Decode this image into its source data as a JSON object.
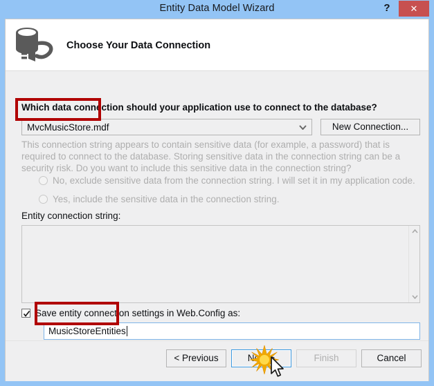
{
  "window": {
    "title": "Entity Data Model Wizard",
    "help_label": "?",
    "close_label": "✕"
  },
  "header": {
    "title": "Choose Your Data Connection",
    "icon": "database-connection-icon"
  },
  "main": {
    "prompt": "Which data connection should your application use to connect to the database?",
    "connection": {
      "selected_value": "MvcMusicStore.mdf",
      "dropdown_icon": "chevron-down-icon",
      "new_connection_label": "New Connection..."
    },
    "sensitive_data_notice": "This connection string appears to contain sensitive data (for example, a password) that is required to connect to the database. Storing sensitive data in the connection string can be a security risk. Do you want to include this sensitive data in the connection string?",
    "radio_options": [
      {
        "label": "No, exclude sensitive data from the connection string. I will set it in my application code.",
        "selected": false,
        "enabled": false
      },
      {
        "label": "Yes, include the sensitive data in the connection string.",
        "selected": false,
        "enabled": false
      }
    ],
    "entity_connection_string": {
      "label": "Entity connection string:",
      "value": "",
      "scroll_up_icon": "chevron-up-icon",
      "scroll_down_icon": "chevron-down-icon"
    },
    "save_settings": {
      "checkbox_label": "Save entity connection settings in Web.Config as:",
      "checked": true,
      "check_icon": "checkmark-icon",
      "name_value": "MusicStoreEntities"
    }
  },
  "footer": {
    "buttons": [
      {
        "label": "< Previous",
        "enabled": true,
        "default": false
      },
      {
        "label": "Next >",
        "enabled": true,
        "default": true
      },
      {
        "label": "Finish",
        "enabled": false,
        "default": false
      },
      {
        "label": "Cancel",
        "enabled": true,
        "default": false
      }
    ]
  },
  "annotations": {
    "highlight_color": "#b00000",
    "click_indicator": "starburst-click-icon",
    "cursor": "mouse-pointer-icon"
  },
  "colors": {
    "titlebar": "#93c4f5",
    "close_button": "#c75050",
    "dialog_background": "#efeff0",
    "header_background": "#ffffff",
    "disabled_text": "#aeaeae",
    "focus_border": "#3c99e0"
  }
}
